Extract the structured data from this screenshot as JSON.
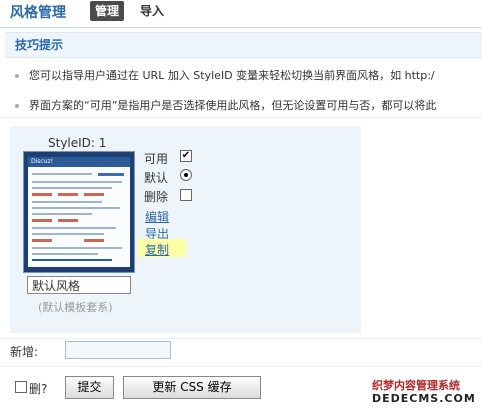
{
  "header": {
    "title": "风格管理",
    "tabs": [
      {
        "label": "管理"
      },
      {
        "label": "导入"
      }
    ]
  },
  "tips": {
    "title": "技巧提示",
    "items": [
      "您可以指导用户通过在 URL 加入 StyleID 变量来轻松切换当前界面风格，如 http:/",
      "界面方案的“可用”是指用户是否选择使用此风格，但无论设置可用与否，都可以将此"
    ]
  },
  "style_card": {
    "style_id_text": "StyleID: 1",
    "thumbnail_logo": "Discuz!",
    "name_value": "默认风格",
    "template_set": "(默认模板套系)",
    "options": {
      "available_label": "可用",
      "available_checked": true,
      "default_label": "默认",
      "default_selected": true,
      "delete_label": "删除",
      "delete_checked": false
    },
    "links": {
      "edit": "编辑",
      "export": "导出",
      "copy": "复制"
    }
  },
  "new_row": {
    "label": "新增:",
    "input_value": ""
  },
  "footer": {
    "delete_label": "删?",
    "delete_checked": false,
    "submit_label": "提交",
    "refresh_label": "更新 CSS 缓存"
  },
  "watermark": {
    "line1": "织梦内容管理系统",
    "line2": "DEDECMS.COM"
  },
  "colors": {
    "accent": "#2a6aa9",
    "tab_active_bg": "#4b4b4b",
    "tips_bg": "#eef5fa",
    "highlight": "#ffffa8"
  }
}
